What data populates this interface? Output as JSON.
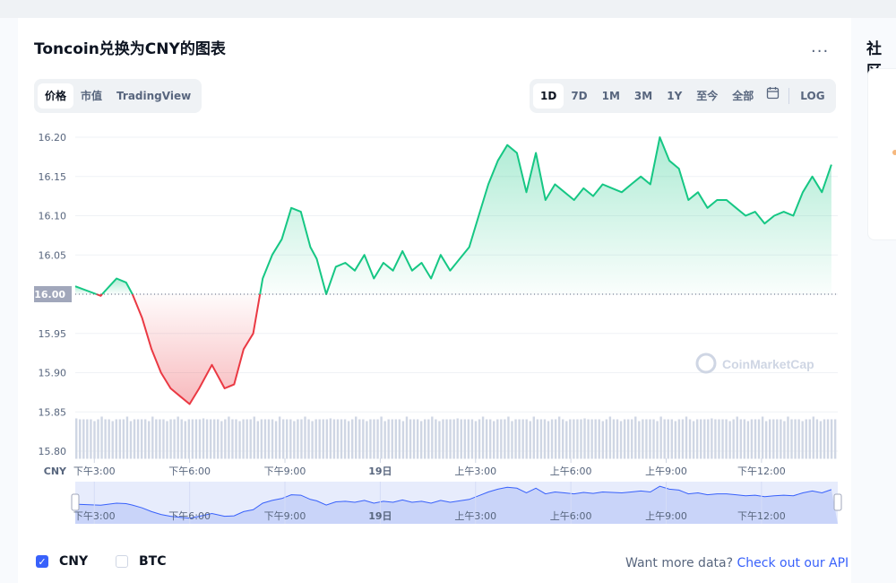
{
  "title": "Toncoin兑换为CNY的图表",
  "more_label": "...",
  "view_tabs": [
    {
      "label": "价格",
      "active": true
    },
    {
      "label": "市值",
      "active": false
    },
    {
      "label": "TradingView",
      "active": false
    }
  ],
  "range_tabs": [
    {
      "label": "1D",
      "active": true
    },
    {
      "label": "7D",
      "active": false
    },
    {
      "label": "1M",
      "active": false
    },
    {
      "label": "3M",
      "active": false
    },
    {
      "label": "1Y",
      "active": false
    },
    {
      "label": "至今",
      "active": false
    },
    {
      "label": "全部",
      "active": false
    }
  ],
  "calendar_icon": "calendar-icon",
  "log_label": "LOG",
  "sidebar_title": "社区",
  "legend": [
    {
      "label": "CNY",
      "checked": true
    },
    {
      "label": "BTC",
      "checked": false
    }
  ],
  "api_prompt": "Want more data?",
  "api_link": "Check out our API",
  "watermark": "CoinMarketCap",
  "colors": {
    "up": "#16c784",
    "down": "#ea3943",
    "accent": "#3861fb",
    "volume": "#cfd6e4",
    "baseline_label_bg": "#a1a7bb"
  },
  "chart_data": {
    "type": "area",
    "unit": "CNY",
    "ylim": [
      15.8,
      16.2
    ],
    "yticks": [
      "16.20",
      "16.15",
      "16.10",
      "16.05",
      "16.00",
      "15.95",
      "15.90",
      "15.85",
      "15.80"
    ],
    "baseline": 16.0,
    "baseline_label": "16.00",
    "xticks": [
      "下午3:00",
      "下午6:00",
      "下午9:00",
      "19日",
      "上午3:00",
      "上午6:00",
      "上午9:00",
      "下午12:00"
    ],
    "x_hours": [
      0,
      0.8,
      1.3,
      1.6,
      1.8,
      2.1,
      2.4,
      2.7,
      3.0,
      3.3,
      3.6,
      3.9,
      4.3,
      4.7,
      5.0,
      5.3,
      5.6,
      5.9,
      6.2,
      6.5,
      6.8,
      7.1,
      7.4,
      7.6,
      7.9,
      8.2,
      8.5,
      8.8,
      9.1,
      9.4,
      9.7,
      10.0,
      10.3,
      10.6,
      10.9,
      11.2,
      11.5,
      11.8,
      12.1,
      12.4,
      12.7,
      13.0,
      13.3,
      13.6,
      13.9,
      14.2,
      14.5,
      14.8,
      15.1,
      15.4,
      15.7,
      16.0,
      16.3,
      16.6,
      16.9,
      17.2,
      17.5,
      17.8,
      18.1,
      18.4,
      18.7,
      19.0,
      19.3,
      19.6,
      19.9,
      20.2,
      20.5,
      20.8,
      21.1,
      21.4,
      21.7,
      22.0,
      22.3,
      22.6,
      22.9,
      23.2,
      23.5,
      23.8
    ],
    "price": [
      16.01,
      15.998,
      16.02,
      16.015,
      16.0,
      15.97,
      15.93,
      15.9,
      15.88,
      15.87,
      15.86,
      15.88,
      15.91,
      15.88,
      15.885,
      15.93,
      15.95,
      16.02,
      16.05,
      16.07,
      16.11,
      16.105,
      16.06,
      16.045,
      16.0,
      16.035,
      16.04,
      16.03,
      16.05,
      16.02,
      16.04,
      16.03,
      16.055,
      16.03,
      16.04,
      16.02,
      16.05,
      16.03,
      16.045,
      16.06,
      16.1,
      16.14,
      16.17,
      16.19,
      16.18,
      16.13,
      16.18,
      16.12,
      16.14,
      16.13,
      16.12,
      16.135,
      16.125,
      16.14,
      16.135,
      16.13,
      16.14,
      16.15,
      16.14,
      16.2,
      16.17,
      16.16,
      16.12,
      16.13,
      16.11,
      16.12,
      16.12,
      16.11,
      16.1,
      16.105,
      16.09,
      16.1,
      16.105,
      16.1,
      16.13,
      16.15,
      16.13,
      16.165
    ],
    "navigator_ticks": [
      "下午3:00",
      "下午6:00",
      "下午9:00",
      "19日",
      "上午3:00",
      "上午6:00",
      "上午9:00",
      "下午12:00"
    ]
  }
}
